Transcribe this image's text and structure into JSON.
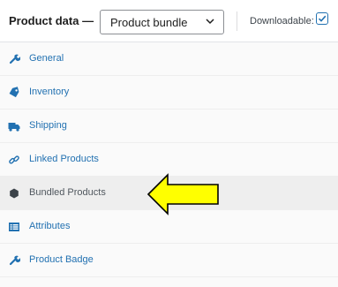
{
  "header": {
    "title": "Product data —",
    "product_type": "Product bundle",
    "downloadable_label": "Downloadable:",
    "downloadable_checked": true
  },
  "tabs": [
    {
      "label": "General",
      "icon": "wrench-icon",
      "active": false
    },
    {
      "label": "Inventory",
      "icon": "tag-icon",
      "active": false
    },
    {
      "label": "Shipping",
      "icon": "truck-icon",
      "active": false
    },
    {
      "label": "Linked Products",
      "icon": "link-icon",
      "active": false
    },
    {
      "label": "Bundled Products",
      "icon": "hexagon-icon",
      "active": true
    },
    {
      "label": "Attributes",
      "icon": "list-icon",
      "active": false
    },
    {
      "label": "Product Badge",
      "icon": "wrench-icon",
      "active": false
    }
  ],
  "annotation": {
    "type": "arrow-pointing-left",
    "fill": "#ffff00",
    "stroke": "#000000"
  },
  "colors": {
    "link": "#2271b1",
    "active_text": "#50575e",
    "active_bg": "#eeeeee",
    "tab_bg": "#fafafa"
  }
}
